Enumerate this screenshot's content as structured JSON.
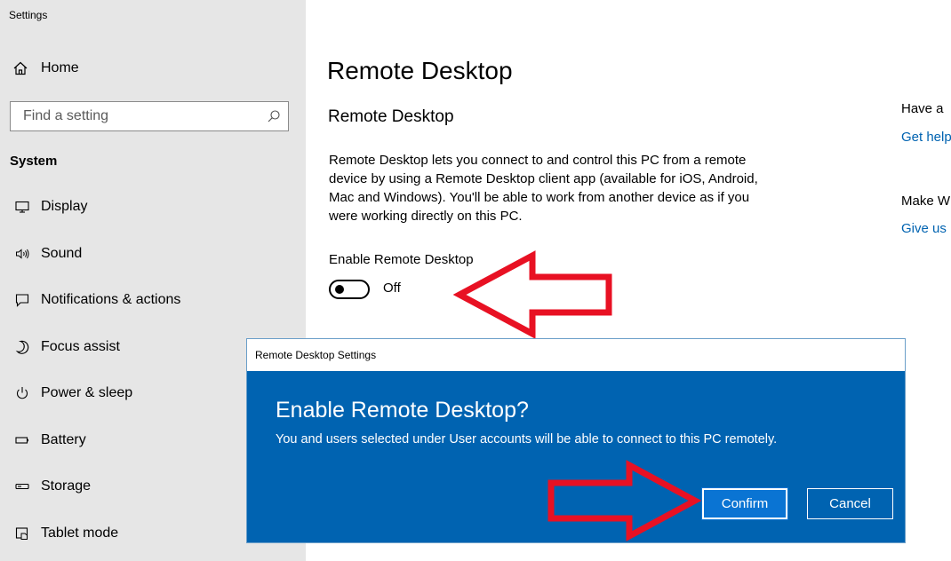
{
  "window": {
    "title": "Settings"
  },
  "sidebar": {
    "home_label": "Home",
    "search_placeholder": "Find a setting",
    "section_title": "System",
    "items": [
      {
        "label": "Display",
        "icon": "monitor-icon"
      },
      {
        "label": "Sound",
        "icon": "speaker-icon"
      },
      {
        "label": "Notifications & actions",
        "icon": "notifications-icon"
      },
      {
        "label": "Focus assist",
        "icon": "moon-icon"
      },
      {
        "label": "Power & sleep",
        "icon": "power-icon"
      },
      {
        "label": "Battery",
        "icon": "battery-icon"
      },
      {
        "label": "Storage",
        "icon": "storage-icon"
      },
      {
        "label": "Tablet mode",
        "icon": "tablet-mode-icon"
      }
    ]
  },
  "main": {
    "title": "Remote Desktop",
    "section_title": "Remote Desktop",
    "description": "Remote Desktop lets you connect to and control this PC from a remote device by using a Remote Desktop client app (available for iOS, Android, Mac and Windows). You'll be able to work from another device as if you were working directly on this PC.",
    "toggle_label": "Enable Remote Desktop",
    "toggle_state": "Off",
    "related": {
      "question_1": "Have a",
      "link_1": "Get help",
      "question_2": "Make W",
      "link_2": "Give us"
    }
  },
  "dialog": {
    "window_title": "Remote Desktop Settings",
    "heading": "Enable Remote Desktop?",
    "body": "You and users selected under User accounts will be able to connect to this PC remotely.",
    "confirm_label": "Confirm",
    "cancel_label": "Cancel"
  },
  "colors": {
    "sidebar_bg": "#e6e6e6",
    "dialog_bg": "#0063b1",
    "confirm_bg": "#0a74d3",
    "link": "#0063b1",
    "annotation_arrow": "#e81123"
  }
}
